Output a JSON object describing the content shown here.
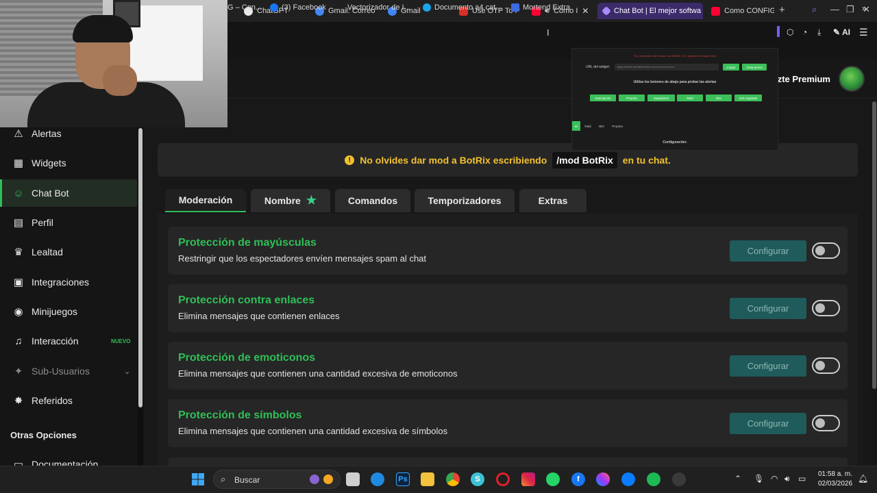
{
  "browser": {
    "tabs": [
      {
        "label": "ChatGPT",
        "color": "#f2f2f2"
      },
      {
        "label": "Gmail: Correo",
        "color": "#4285f4"
      },
      {
        "label": "Gmail",
        "color": "#4285f4"
      },
      {
        "label": "Use OTP To P",
        "color": "#d93025"
      },
      {
        "label": "Cómo I",
        "color": "#ff0033"
      },
      {
        "label": "Chat Bot | El mejor softwa",
        "color": "#a98bff"
      },
      {
        "label": "Como CONFIG",
        "color": "#ff0033"
      }
    ],
    "toolbar_ai_label": "AI",
    "bookmarks": [
      {
        "label": "G – Con..."
      },
      {
        "label": "(3) Facebook"
      },
      {
        "label": "Vectorizador de I..."
      },
      {
        "label": "Documento a4 cat..."
      },
      {
        "label": "Mortend Extra"
      }
    ]
  },
  "header": {
    "premium_label": "zte Premium"
  },
  "popup": {
    "warning_text": "No compartas este enlace con NADIE, ni te pegues en ningún chat",
    "url_label": "URL del widget:",
    "url_value": "https://botrix.live/alerts?bid=••••••••••••••••••••••••",
    "copy_button": "Copiar",
    "view_button": "Vista previa",
    "instructions": "Utiliza los botones de abajo para probar las alertas",
    "alert_buttons": [
      "Suscripción",
      "Propina",
      "Seguidores",
      "Raid",
      "Bits",
      "Sub regalada"
    ],
    "tabs": [
      "es",
      "Raid",
      "Bits",
      "Propina"
    ],
    "config_label": "Configuración:"
  },
  "sidebar": {
    "items": [
      {
        "label": "Alertas",
        "icon": "warning-icon",
        "glyph": "⚠"
      },
      {
        "label": "Widgets",
        "icon": "grid-icon",
        "glyph": "▦"
      },
      {
        "label": "Chat Bot",
        "icon": "robot-icon",
        "glyph": "☺"
      },
      {
        "label": "Perfil",
        "icon": "id-card-icon",
        "glyph": "▤"
      },
      {
        "label": "Lealtad",
        "icon": "trophy-icon",
        "glyph": "♛"
      },
      {
        "label": "Integraciones",
        "icon": "plug-icon",
        "glyph": "▣"
      },
      {
        "label": "Minijuegos",
        "icon": "gamepad-icon",
        "glyph": "◉"
      },
      {
        "label": "Interacción",
        "icon": "music-icon",
        "glyph": "♫"
      },
      {
        "label": "Sub-Usuarios",
        "icon": "users-icon",
        "glyph": "✦"
      },
      {
        "label": "Referidos",
        "icon": "user-group-icon",
        "glyph": "✸"
      }
    ],
    "new_badge": "NUEVO",
    "section_title": "Otras Opciones",
    "doc_item": "Documentación"
  },
  "notice": {
    "text_before": "No olvides dar mod a BotRix escribiendo",
    "command": "/mod BotRix",
    "text_after": "en tu chat."
  },
  "tabs": [
    {
      "label": "Moderación",
      "active": true
    },
    {
      "label": "Nombre",
      "active": false
    },
    {
      "label": "Comandos",
      "active": false
    },
    {
      "label": "Temporizadores",
      "active": false
    },
    {
      "label": "Extras",
      "active": false
    }
  ],
  "cards": [
    {
      "title": "Protección de mayúsculas",
      "description": "Restringir que los espectadores envíen mensajes spam al chat",
      "button": "Configurar",
      "enabled": false
    },
    {
      "title": "Protección contra enlaces",
      "description": "Elimina mensajes que contienen enlaces",
      "button": "Configurar",
      "enabled": false
    },
    {
      "title": "Protección de emoticonos",
      "description": "Elimina mensajes que contienen una cantidad excesiva de emoticonos",
      "button": "Configurar",
      "enabled": false
    },
    {
      "title": "Protección de símbolos",
      "description": "Elimina mensajes que contienen una cantidad excesiva de símbolos",
      "button": "Configurar",
      "enabled": false
    }
  ],
  "taskbar": {
    "search_placeholder": "Buscar",
    "time": "01:58 a. m.",
    "date": "02/03/2026"
  },
  "colors": {
    "accent": "#2fbf57",
    "warning": "#f2c12e",
    "config_button": "#1f5b5b"
  }
}
